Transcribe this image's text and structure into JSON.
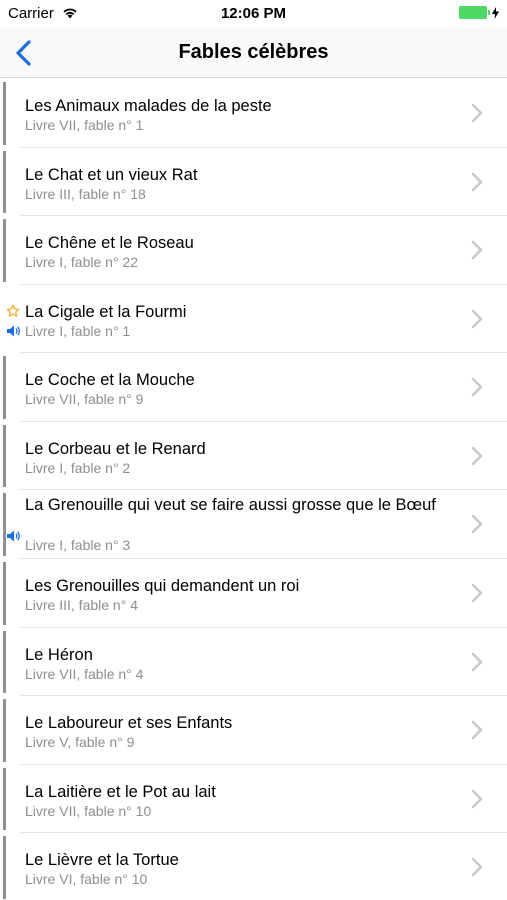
{
  "status": {
    "carrier": "Carrier",
    "time": "12:06 PM"
  },
  "nav": {
    "title": "Fables célèbres"
  },
  "colors": {
    "accent": "#1a6fe0",
    "chevron": "#c7c7cc",
    "subtitle": "#8e8e93",
    "battery": "#4cd964",
    "star": "#f5a623"
  },
  "fables": [
    {
      "title": "Les Animaux malades de la peste",
      "subtitle": "Livre VII, fable n° 1"
    },
    {
      "title": "Le Chat et un vieux Rat",
      "subtitle": "Livre III, fable n° 18"
    },
    {
      "title": "Le Chêne et le Roseau",
      "subtitle": "Livre I, fable n° 22"
    },
    {
      "title": "La Cigale et la Fourmi",
      "subtitle": "Livre I, fable n° 1",
      "favorite": true,
      "audio": true
    },
    {
      "title": "Le Coche et la Mouche",
      "subtitle": "Livre VII, fable n° 9"
    },
    {
      "title": "Le Corbeau et le Renard",
      "subtitle": "Livre I, fable n° 2"
    },
    {
      "title": "La Grenouille qui veut se faire aussi grosse que le Bœuf",
      "subtitle": "Livre I, fable n° 3",
      "audio": true
    },
    {
      "title": "Les Grenouilles qui demandent un roi",
      "subtitle": "Livre III, fable n° 4"
    },
    {
      "title": "Le Héron",
      "subtitle": "Livre VII, fable n° 4"
    },
    {
      "title": "Le Laboureur et ses Enfants",
      "subtitle": "Livre V, fable n° 9"
    },
    {
      "title": "La Laitière et le Pot au lait",
      "subtitle": "Livre VII, fable n° 10"
    },
    {
      "title": "Le Lièvre et la Tortue",
      "subtitle": "Livre VI, fable n° 10"
    }
  ]
}
